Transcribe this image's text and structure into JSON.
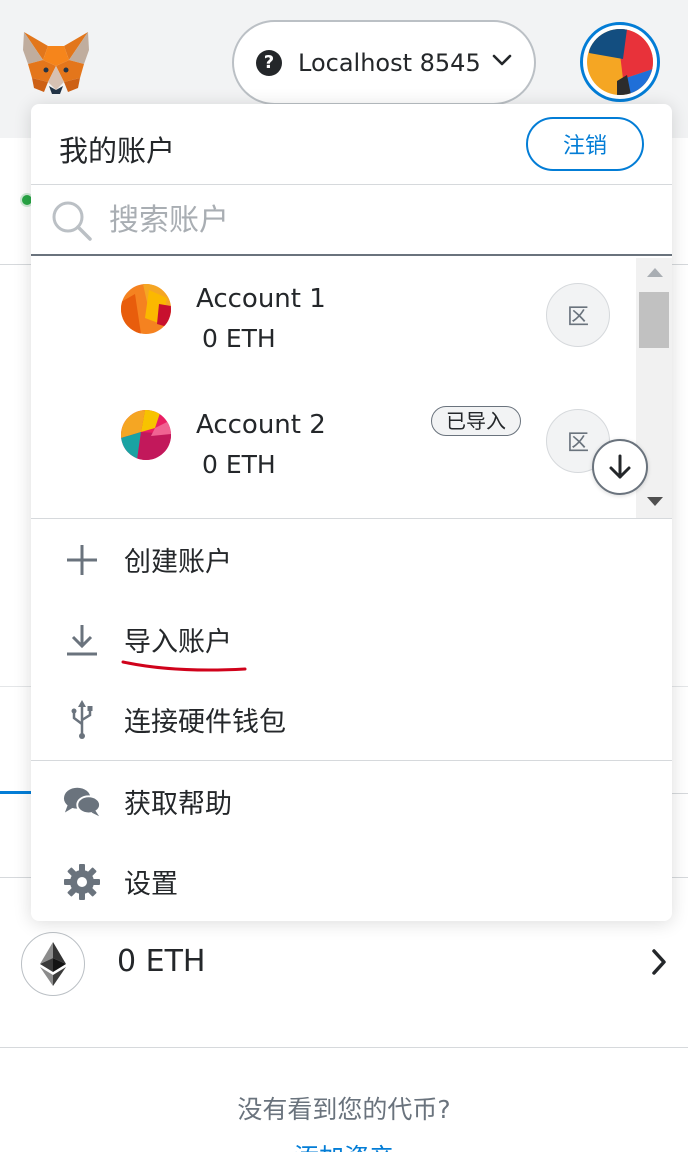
{
  "header": {
    "network_label": "Localhost 8545",
    "network_help_glyph": "?"
  },
  "menu": {
    "title": "我的账户",
    "logout_label": "注销",
    "search_placeholder": "搜索账户",
    "accounts": [
      {
        "name": "Account 1",
        "balance": "0 ETH",
        "badge": "",
        "key_glyph": "区"
      },
      {
        "name": "Account 2",
        "balance": "0 ETH",
        "badge": "已导入",
        "key_glyph": "区"
      }
    ],
    "items": [
      {
        "label": "创建账户",
        "icon": "plus-icon"
      },
      {
        "label": "导入账户",
        "icon": "download-icon"
      },
      {
        "label": "连接硬件钱包",
        "icon": "usb-icon"
      },
      {
        "label": "获取帮助",
        "icon": "chat-bubbles-icon"
      },
      {
        "label": "设置",
        "icon": "gear-icon"
      }
    ]
  },
  "main": {
    "asset_balance": "0 ETH",
    "no_token_text": "没有看到您的代币?",
    "add_token_link": "添加资产"
  },
  "colors": {
    "accent": "#037dd6",
    "annotation": "#d0021b",
    "status_green": "#28a745"
  }
}
